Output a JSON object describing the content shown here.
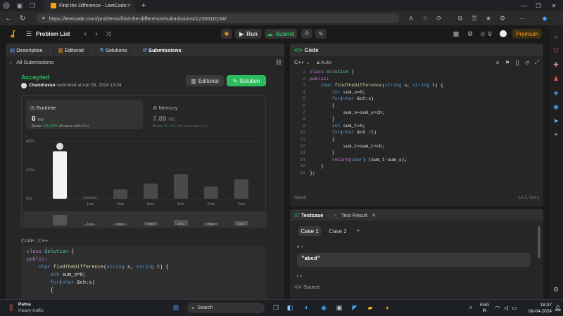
{
  "browser": {
    "tab_title": "Find the Difference - LeetCode",
    "new_tab": "+",
    "url": "https://leetcode.com/problems/find-the-difference/submissions/1226510154/"
  },
  "nav": {
    "problem_list": "Problem List",
    "run": "Run",
    "submit": "Submit",
    "streak": "0",
    "premium": "Premium"
  },
  "left": {
    "tabs": [
      "Description",
      "Editorial",
      "Solutions",
      "Submissions"
    ],
    "back": "All Submissions",
    "status": "Accepted",
    "user": "Chandravan",
    "submitted": "submitted at Apr 08, 2024 13:34",
    "editorial_btn": "Editorial",
    "solution_btn": "Solution",
    "runtime_label": "Runtime",
    "runtime_value": "0",
    "runtime_unit": "ms",
    "beats_prefix": "Beats",
    "beats_runtime": "100.00%",
    "beats_suffix": "of users with C++",
    "memory_label": "Memory",
    "memory_value": "7.89",
    "memory_unit": "MB",
    "beats_memory": "52.19%",
    "code_label": "Code",
    "code_lang": "C++"
  },
  "chart_data": {
    "type": "bar",
    "categories": [
      "0ms",
      "1ms",
      "2ms",
      "3ms",
      "4ms",
      "5ms",
      "6ms"
    ],
    "tick_labels": [
      "",
      "1ms",
      "2ms",
      "3ms",
      "4ms",
      "5ms",
      "6ms"
    ],
    "values": [
      33,
      1.5,
      6.5,
      10.5,
      17,
      8.5,
      13.5
    ],
    "highlight_index": 0,
    "yticks": [
      "40%",
      "20%",
      "0%"
    ],
    "ylim": [
      0,
      40
    ]
  },
  "code": {
    "title": "Code",
    "lang": "C++",
    "mode": "Auto",
    "saved": "Saved",
    "cursor": "Ln 1, Col 1",
    "lines": [
      "class Solution {",
      "public:",
      "    char findTheDifference(string s, string t) {",
      "        int sum_s=0;",
      "        for(char &ch:s)",
      "        {",
      "            sum_s=sum_s+ch;",
      "        }",
      "        int sum_t=0;",
      "        for(char &ch :t)",
      "        {",
      "            sum_t=sum_t+ch;",
      "        }",
      "        return(char) (sum_t-sum_s);",
      "    }",
      "};"
    ],
    "preview_lines": [
      "class Solution {",
      "public:",
      "    char findTheDifference(string s, string t) {",
      "        int sum_s=0;",
      "        for(char &ch:s)",
      "        {"
    ]
  },
  "testcase": {
    "tab": "Testcase",
    "result_tab": "Test Result",
    "case1": "Case 1",
    "case2": "Case 2",
    "add": "+",
    "s_label": "s =",
    "s_value": "\"abcd\"",
    "t_label": "t =",
    "source": "Source"
  },
  "taskbar": {
    "weather_city": "Patna",
    "weather_desc": "Heavy traffic",
    "search": "Search",
    "lang1": "ENG",
    "lang2": "IN",
    "time": "18:37",
    "date": "08-04-2024"
  },
  "colors": {
    "accent": "#2cbb5d",
    "orange": "#ffa116",
    "blue": "#3b82f6"
  }
}
